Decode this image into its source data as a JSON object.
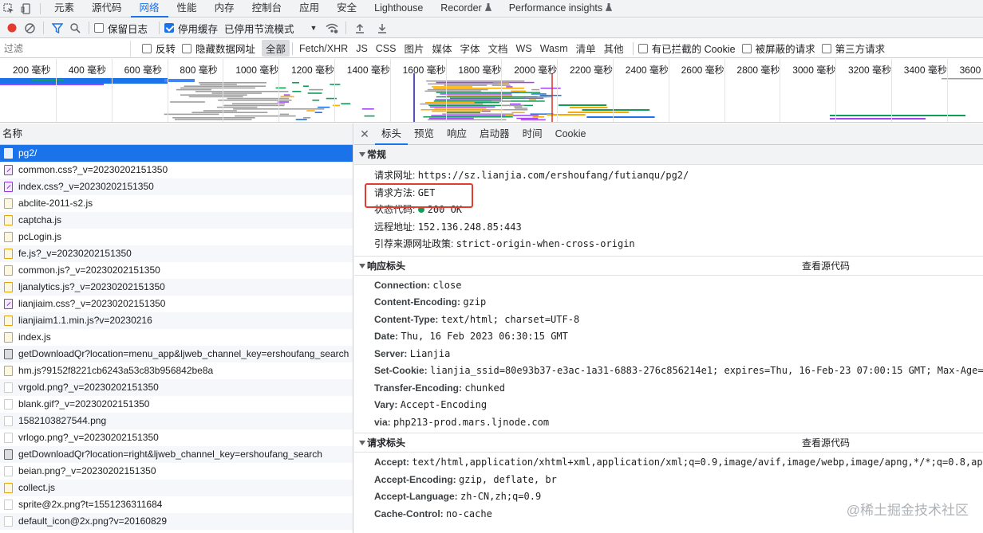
{
  "top_tabs": [
    "元素",
    "源代码",
    "网络",
    "性能",
    "内存",
    "控制台",
    "应用",
    "安全",
    "Lighthouse",
    "Recorder",
    "Performance insights"
  ],
  "top_active_index": 2,
  "toolbar": {
    "preserve_log": "保留日志",
    "disable_cache": "停用缓存",
    "throttle": "已停用节流模式"
  },
  "filter": {
    "placeholder": "过滤",
    "invert": "反转",
    "hide_data_urls": "隐藏数据网址",
    "types": [
      "全部",
      "Fetch/XHR",
      "JS",
      "CSS",
      "图片",
      "媒体",
      "字体",
      "文档",
      "WS",
      "Wasm",
      "清单",
      "其他"
    ],
    "blocked_cookies": "有已拦截的 Cookie",
    "blocked_requests": "被屏蔽的请求",
    "third_party": "第三方请求"
  },
  "timeline_ticks": [
    "200 毫秒",
    "400 毫秒",
    "600 毫秒",
    "800 毫秒",
    "1000 毫秒",
    "1200 毫秒",
    "1400 毫秒",
    "1600 毫秒",
    "1800 毫秒",
    "2000 毫秒",
    "2200 毫秒",
    "2400 毫秒",
    "2600 毫秒",
    "2800 毫秒",
    "3000 毫秒",
    "3200 毫秒",
    "3400 毫秒",
    "3600 毫秒"
  ],
  "request_list": {
    "header": "名称",
    "rows": [
      {
        "name": "pg2/",
        "type": "doc"
      },
      {
        "name": "common.css?_v=20230202151350",
        "type": "css"
      },
      {
        "name": "index.css?_v=20230202151350",
        "type": "css"
      },
      {
        "name": "abclite-2011-s2.js",
        "type": "js"
      },
      {
        "name": "captcha.js",
        "type": "js"
      },
      {
        "name": "pcLogin.js",
        "type": "js"
      },
      {
        "name": "fe.js?_v=20230202151350",
        "type": "js"
      },
      {
        "name": "common.js?_v=20230202151350",
        "type": "js"
      },
      {
        "name": "ljanalytics.js?_v=20230202151350",
        "type": "js"
      },
      {
        "name": "lianjiaim.css?_v=20230202151350",
        "type": "css"
      },
      {
        "name": "lianjiaim1.1.min.js?v=20230216",
        "type": "js"
      },
      {
        "name": "index.js",
        "type": "js"
      },
      {
        "name": "getDownloadQr?location=menu_app&ljweb_channel_key=ershoufang_search",
        "type": "img"
      },
      {
        "name": "hm.js?9152f8221cb6243a53c83b956842be8a",
        "type": "js"
      },
      {
        "name": "vrgold.png?_v=20230202151350",
        "type": "blank"
      },
      {
        "name": "blank.gif?_v=20230202151350",
        "type": "blank"
      },
      {
        "name": "1582103827544.png",
        "type": "blank"
      },
      {
        "name": "vrlogo.png?_v=20230202151350",
        "type": "blank"
      },
      {
        "name": "getDownloadQr?location=right&ljweb_channel_key=ershoufang_search",
        "type": "img"
      },
      {
        "name": "beian.png?_v=20230202151350",
        "type": "blank"
      },
      {
        "name": "collect.js",
        "type": "js"
      },
      {
        "name": "sprite@2x.png?t=1551236311684",
        "type": "blank"
      },
      {
        "name": "default_icon@2x.png?v=20160829",
        "type": "blank"
      }
    ]
  },
  "detail": {
    "tabs": [
      "标头",
      "预览",
      "响应",
      "启动器",
      "时间",
      "Cookie"
    ],
    "general": {
      "title": "常规",
      "rows": [
        {
          "k": "请求网址:",
          "v": "https://sz.lianjia.com/ershoufang/futianqu/pg2/"
        },
        {
          "k": "请求方法:",
          "v": "GET"
        },
        {
          "k": "状态代码:",
          "v": "200 OK"
        },
        {
          "k": "远程地址:",
          "v": "152.136.248.85:443"
        },
        {
          "k": "引荐来源网址政策:",
          "v": "strict-origin-when-cross-origin"
        }
      ]
    },
    "response_headers": {
      "title": "响应标头",
      "view_source": "查看源代码",
      "rows": [
        {
          "k": "Connection:",
          "v": "close"
        },
        {
          "k": "Content-Encoding:",
          "v": "gzip"
        },
        {
          "k": "Content-Type:",
          "v": "text/html; charset=UTF-8"
        },
        {
          "k": "Date:",
          "v": "Thu, 16 Feb 2023 06:30:15 GMT"
        },
        {
          "k": "Server:",
          "v": "Lianjia"
        },
        {
          "k": "Set-Cookie:",
          "v": "lianjia_ssid=80e93b37-e3ac-1a31-6883-276c856214e1; expires=Thu, 16-Feb-23 07:00:15 GMT; Max-Age="
        },
        {
          "k": "Transfer-Encoding:",
          "v": "chunked"
        },
        {
          "k": "Vary:",
          "v": "Accept-Encoding"
        },
        {
          "k": "via:",
          "v": "php213-prod.mars.ljnode.com"
        }
      ]
    },
    "request_headers": {
      "title": "请求标头",
      "view_source": "查看源代码",
      "rows": [
        {
          "k": "Accept:",
          "v": "text/html,application/xhtml+xml,application/xml;q=0.9,image/avif,image/webp,image/apng,*/*;q=0.8,ap"
        },
        {
          "k": "Accept-Encoding:",
          "v": "gzip, deflate, br"
        },
        {
          "k": "Accept-Language:",
          "v": "zh-CN,zh;q=0.9"
        },
        {
          "k": "Cache-Control:",
          "v": "no-cache"
        }
      ]
    }
  },
  "watermark": "@稀土掘金技术社区",
  "colors": {
    "accent": "#1a73e8",
    "record": "#e33b2e",
    "highlight": "#e33b2e"
  }
}
